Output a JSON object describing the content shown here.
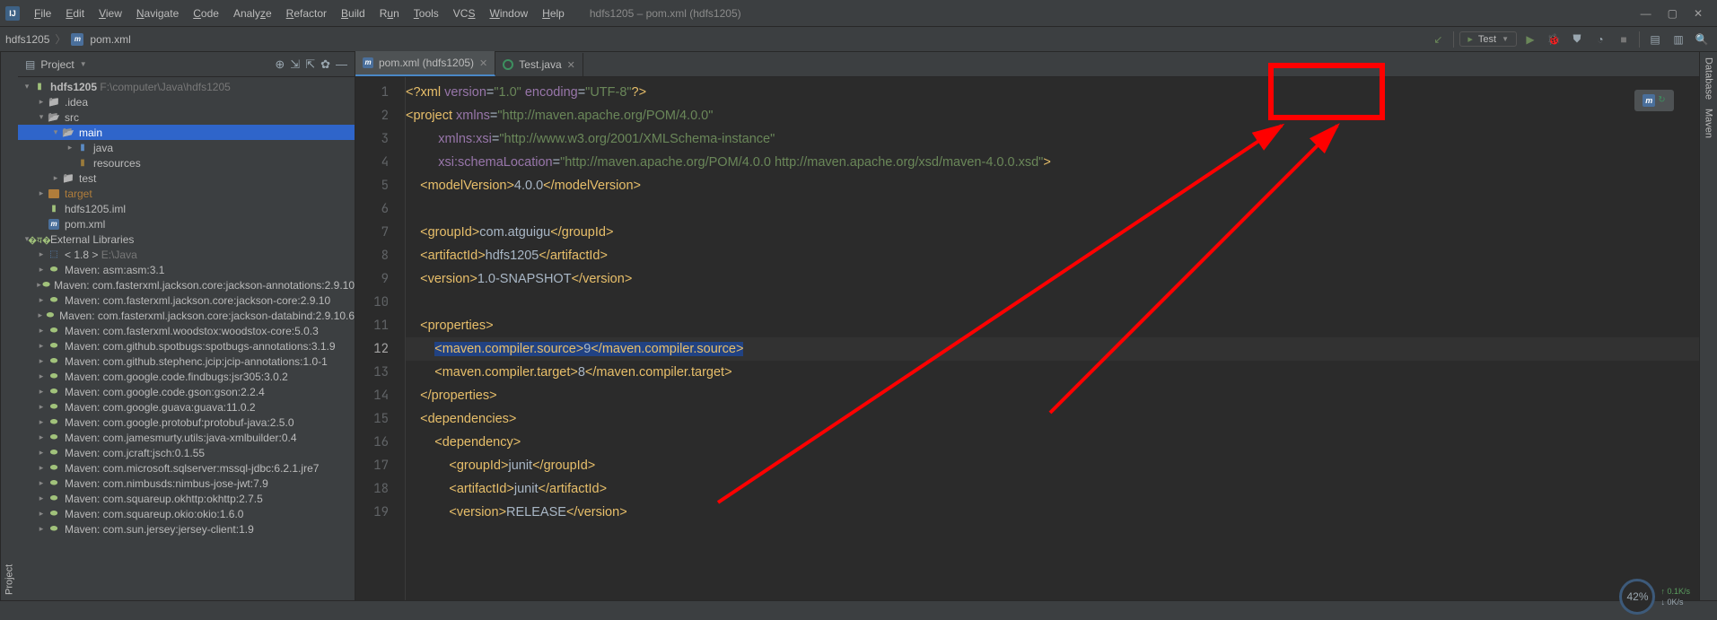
{
  "window": {
    "title": "hdfs1205 – pom.xml (hdfs1205)"
  },
  "menu": [
    "File",
    "Edit",
    "View",
    "Navigate",
    "Code",
    "Analyze",
    "Refactor",
    "Build",
    "Run",
    "Tools",
    "VCS",
    "Window",
    "Help"
  ],
  "breadcrumb": {
    "project": "hdfs1205",
    "file": "pom.xml"
  },
  "toolbar": {
    "run_config": "Test"
  },
  "project_panel": {
    "title": "Project"
  },
  "tree": {
    "root": {
      "name": "hdfs1205",
      "path": "F:\\computer\\Java\\hdfs1205"
    },
    "idea": ".idea",
    "src": "src",
    "main": "main",
    "java": "java",
    "resources": "resources",
    "test": "test",
    "target": "target",
    "iml": "hdfs1205.iml",
    "pom": "pom.xml",
    "ext": "External Libraries",
    "jdk": "< 1.8 >",
    "jdk_path": "E:\\Java",
    "libs": [
      "Maven: asm:asm:3.1",
      "Maven: com.fasterxml.jackson.core:jackson-annotations:2.9.10",
      "Maven: com.fasterxml.jackson.core:jackson-core:2.9.10",
      "Maven: com.fasterxml.jackson.core:jackson-databind:2.9.10.6",
      "Maven: com.fasterxml.woodstox:woodstox-core:5.0.3",
      "Maven: com.github.spotbugs:spotbugs-annotations:3.1.9",
      "Maven: com.github.stephenc.jcip:jcip-annotations:1.0-1",
      "Maven: com.google.code.findbugs:jsr305:3.0.2",
      "Maven: com.google.code.gson:gson:2.2.4",
      "Maven: com.google.guava:guava:11.0.2",
      "Maven: com.google.protobuf:protobuf-java:2.5.0",
      "Maven: com.jamesmurty.utils:java-xmlbuilder:0.4",
      "Maven: com.jcraft:jsch:0.1.55",
      "Maven: com.microsoft.sqlserver:mssql-jdbc:6.2.1.jre7",
      "Maven: com.nimbusds:nimbus-jose-jwt:7.9",
      "Maven: com.squareup.okhttp:okhttp:2.7.5",
      "Maven: com.squareup.okio:okio:1.6.0",
      "Maven: com.sun.jersey:jersey-client:1.9"
    ]
  },
  "tabs": [
    {
      "label": "pom.xml (hdfs1205)",
      "type": "pom",
      "active": true
    },
    {
      "label": "Test.java",
      "type": "java",
      "active": false
    }
  ],
  "code": {
    "l1_pi_open": "<?",
    "l1_pi_name": "xml",
    "l1_attr1": " version",
    "l1_eq": "=",
    "l1_v1": "\"1.0\"",
    "l1_attr2": " encoding",
    "l1_v2": "\"UTF-8\"",
    "l1_pi_close": "?>",
    "l2_open": "<",
    "l2_tag": "project",
    "l2_attr": " xmlns",
    "l2_val": "\"http://maven.apache.org/POM/4.0.0\"",
    "l3_attr": "xmlns:xsi",
    "l3_val": "\"http://www.w3.org/2001/XMLSchema-instance\"",
    "l4_attr": "xsi:schemaLocation",
    "l4_val": "\"http://maven.apache.org/POM/4.0.0 http://maven.apache.org/xsd/maven-4.0.0.xsd\"",
    "l4_close": ">",
    "l5_o": "<",
    "l5_t": "modelVersion",
    "l5_c": ">",
    "l5_v": "4.0.0",
    "l5_co": "</",
    "l5_cc": ">",
    "l7_t": "groupId",
    "l7_v": "com.atguigu",
    "l8_t": "artifactId",
    "l8_v": "hdfs1205",
    "l9_t": "version",
    "l9_v": "1.0-SNAPSHOT",
    "l11_t": "properties",
    "l12_t": "maven.compiler.source",
    "l12_v": "9",
    "l13_t": "maven.compiler.target",
    "l13_v": "8",
    "l15_t": "dependencies",
    "l16_t": "dependency",
    "l17_t": "groupId",
    "l17_v": "junit",
    "l18_t": "artifactId",
    "l18_v": "junit",
    "l19_t": "version",
    "l19_v": "RELEASE"
  },
  "right_stripe": {
    "database": "Database",
    "maven": "Maven"
  },
  "netwidget": {
    "pct": "42%",
    "up": "↑ 0.1K/s",
    "down": "↓ 0K/s"
  }
}
